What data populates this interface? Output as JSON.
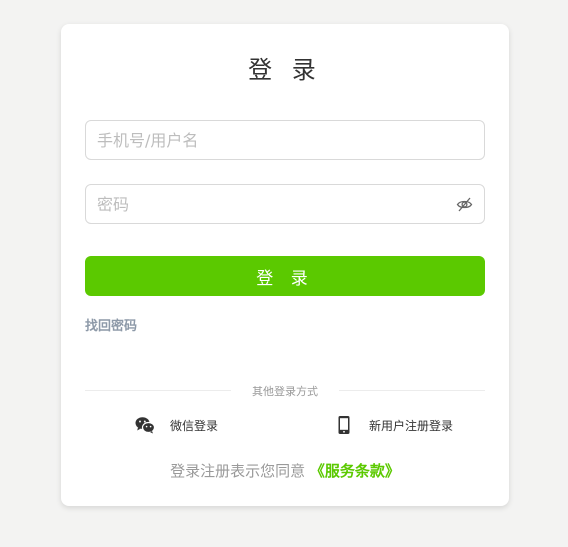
{
  "login": {
    "title": "登 录",
    "phone_placeholder": "手机号/用户名",
    "password_placeholder": "密码",
    "submit_label": "登 录",
    "forgot_label": "找回密码"
  },
  "alternative": {
    "divider_label": "其他登录方式",
    "wechat_label": "微信登录",
    "register_label": "新用户注册登录"
  },
  "agreement": {
    "prefix": "登录注册表示您同意",
    "terms_label": "《服务条款》"
  },
  "icons": {
    "password_toggle": "eye-off-icon",
    "wechat": "wechat-icon",
    "phone": "mobile-phone-icon"
  },
  "colors": {
    "accent": "#5bc900",
    "background": "#f3f3f2",
    "muted": "#8d99a8"
  }
}
